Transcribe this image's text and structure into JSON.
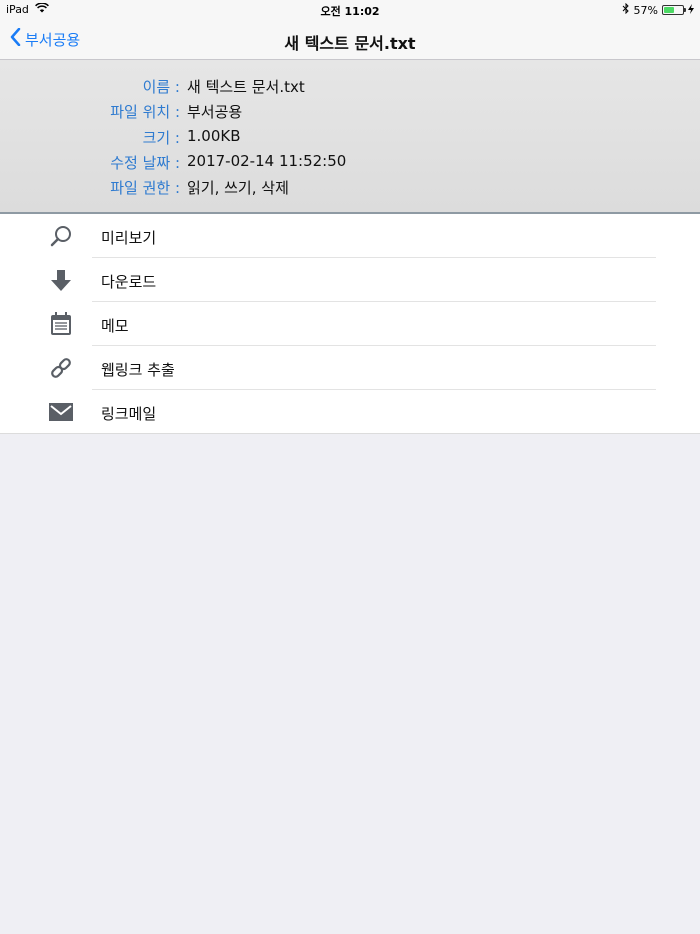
{
  "status": {
    "device": "iPad",
    "time": "오전 11:02",
    "battery_percent": "57%",
    "battery_level": 0.57
  },
  "nav": {
    "back_label": "부서공용",
    "title": "새 텍스트 문서.txt"
  },
  "info": [
    {
      "label": "이름 :",
      "value": "새 텍스트 문서.txt"
    },
    {
      "label": "파일 위치 :",
      "value": "부서공용"
    },
    {
      "label": "크기 :",
      "value": "1.00KB"
    },
    {
      "label": "수정 날짜 :",
      "value": "2017-02-14 11:52:50"
    },
    {
      "label": "파일 권한 :",
      "value": "읽기, 쓰기, 삭제"
    }
  ],
  "menu": [
    {
      "label": "미리보기",
      "icon": "search-icon"
    },
    {
      "label": "다운로드",
      "icon": "download-arrow-icon"
    },
    {
      "label": "메모",
      "icon": "notepad-icon"
    },
    {
      "label": "웹링크 추출",
      "icon": "link-icon"
    },
    {
      "label": "링크메일",
      "icon": "envelope-icon"
    }
  ],
  "colors": {
    "accent": "#1a7cf6",
    "label_blue": "#2f7bd0",
    "icon_gray": "#5a5f66",
    "battery_green": "#4cd964"
  }
}
